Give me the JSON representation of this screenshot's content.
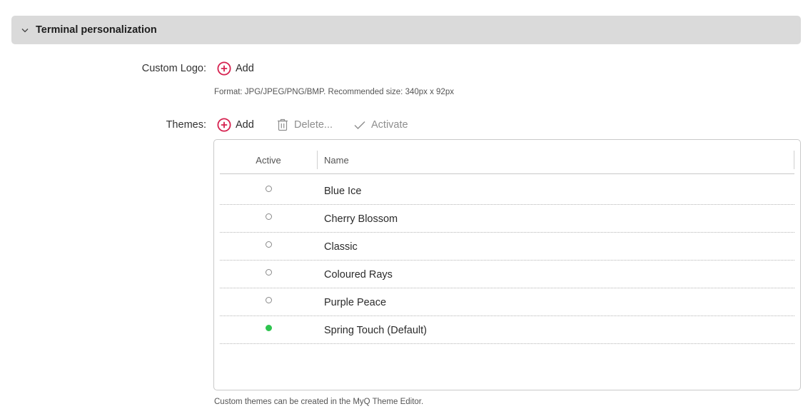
{
  "section": {
    "title": "Terminal personalization"
  },
  "custom_logo": {
    "label": "Custom Logo:",
    "add_label": "Add",
    "format_hint": "Format: JPG/JPEG/PNG/BMP. Recommended size: 340px x 92px"
  },
  "themes": {
    "label": "Themes:",
    "toolbar": {
      "add_label": "Add",
      "delete_label": "Delete...",
      "activate_label": "Activate"
    },
    "columns": {
      "active": "Active",
      "name": "Name"
    },
    "rows": [
      {
        "name": "Blue Ice",
        "active": false
      },
      {
        "name": "Cherry Blossom",
        "active": false
      },
      {
        "name": "Classic",
        "active": false
      },
      {
        "name": "Coloured Rays",
        "active": false
      },
      {
        "name": "Purple Peace",
        "active": false
      },
      {
        "name": "Spring Touch (Default)",
        "active": true
      }
    ],
    "footer_hint": "Custom themes can be created in the MyQ Theme Editor."
  },
  "colors": {
    "accent_red": "#d6214f",
    "active_green": "#2ec44f",
    "header_bg": "#dadada"
  }
}
